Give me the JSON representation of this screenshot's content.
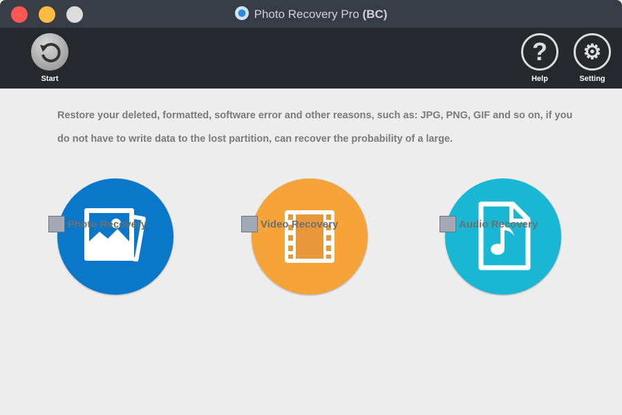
{
  "window": {
    "title": "Photo Recovery Pro",
    "title_suffix": "(BC)",
    "close_color": "#fc5753",
    "min_color": "#fdbc40",
    "zoom_color": "#dcdcdc"
  },
  "toolbar": {
    "start_label": "Start",
    "help_label": "Help",
    "setting_label": "Setting"
  },
  "main": {
    "description": "Restore your deleted, formatted, software error and other reasons, such as: JPG, PNG, GIF and so on, if you do not have to write data to the lost partition, can recover the probability of a large.",
    "options": [
      {
        "label": "Photo Recovery",
        "icon": "photo-icon",
        "color": "#0a77c9",
        "checked": false
      },
      {
        "label": "Video Recovery",
        "icon": "film-icon",
        "color": "#f5a43a",
        "checked": false
      },
      {
        "label": "Audio Recovery",
        "icon": "music-file-icon",
        "color": "#19b7d3",
        "checked": false
      }
    ]
  }
}
